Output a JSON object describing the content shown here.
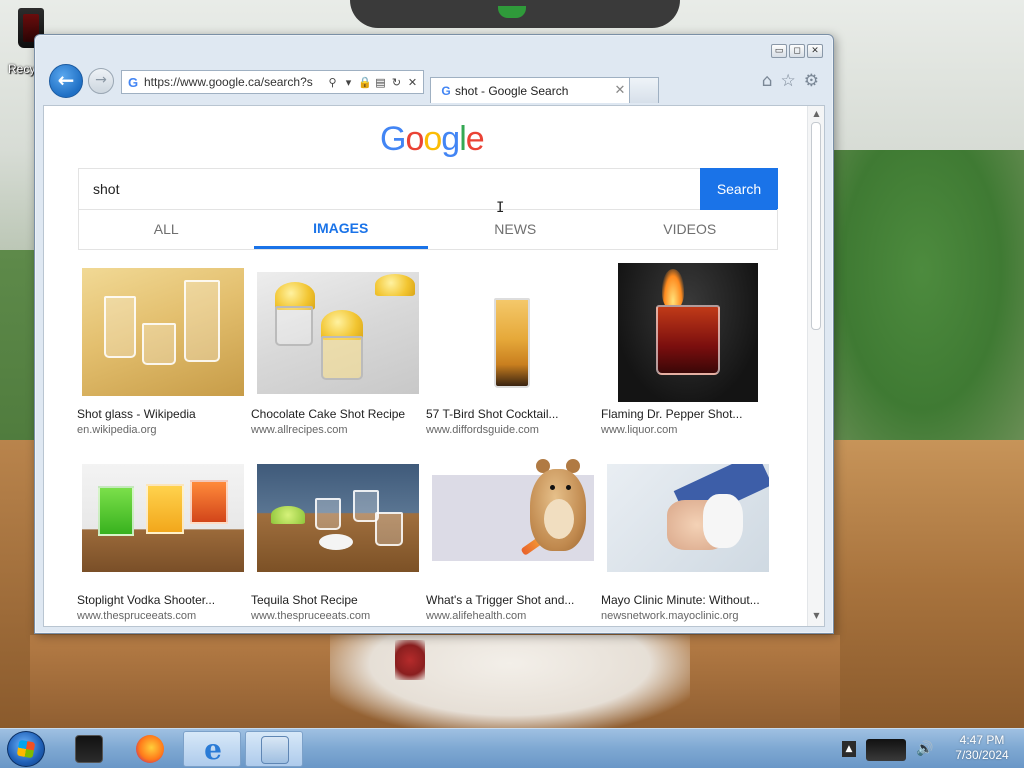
{
  "desktop": {
    "recycle_bin_label": "Recy"
  },
  "browser": {
    "address_url": "https://www.google.ca/search?s",
    "tab_title": "shot - Google Search",
    "controls": {
      "minimize": "▭",
      "maximize": "◻",
      "close": "✕"
    }
  },
  "google": {
    "logo_letters": [
      {
        "ch": "G",
        "color": "#4285F4"
      },
      {
        "ch": "o",
        "color": "#EA4335"
      },
      {
        "ch": "o",
        "color": "#FBBC05"
      },
      {
        "ch": "g",
        "color": "#4285F4"
      },
      {
        "ch": "l",
        "color": "#34A853"
      },
      {
        "ch": "e",
        "color": "#EA4335"
      }
    ],
    "query": "shot",
    "search_button": "Search",
    "tabs": [
      "ALL",
      "IMAGES",
      "NEWS",
      "VIDEOS"
    ],
    "active_tab": "IMAGES",
    "results": [
      {
        "title": "Shot glass - Wikipedia",
        "url": "en.wikipedia.org"
      },
      {
        "title": "Chocolate Cake Shot Recipe",
        "url": "www.allrecipes.com"
      },
      {
        "title": "57 T-Bird Shot Cocktail...",
        "url": "www.diffordsguide.com"
      },
      {
        "title": "Flaming Dr. Pepper Shot...",
        "url": "www.liquor.com"
      },
      {
        "title": "Stoplight Vodka Shooter...",
        "url": "www.thespruceeats.com"
      },
      {
        "title": "Tequila Shot Recipe",
        "url": "www.thespruceeats.com"
      },
      {
        "title": "What's a Trigger Shot and...",
        "url": "www.alifehealth.com"
      },
      {
        "title": "Mayo Clinic Minute: Without...",
        "url": "newsnetwork.mayoclinic.org"
      }
    ]
  },
  "taskbar": {
    "time": "4:47 PM",
    "date": "7/30/2024"
  },
  "colors": {
    "google_blue_button": "#1a73e8",
    "taskbar": "#7ea8d2"
  }
}
